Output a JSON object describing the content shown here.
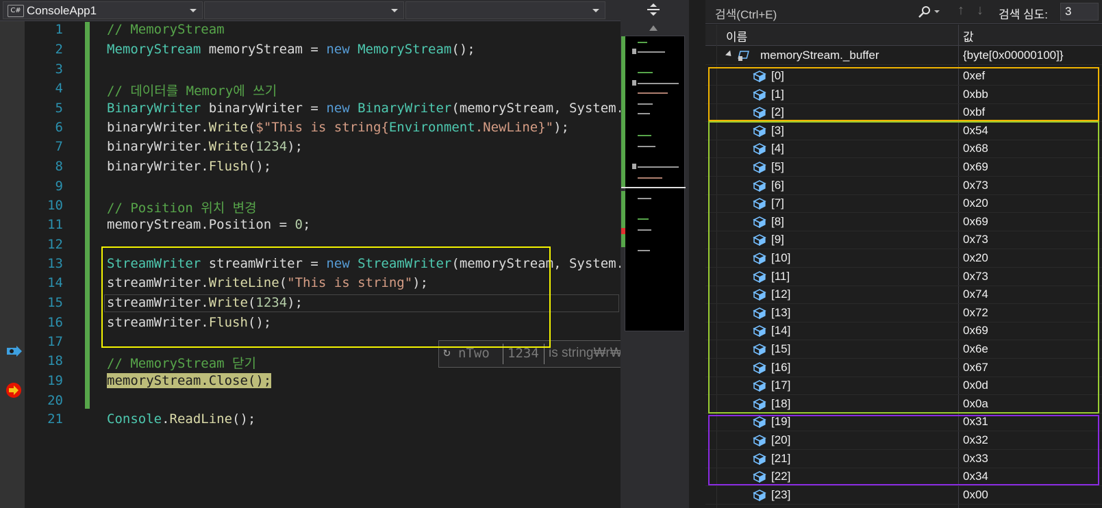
{
  "editor": {
    "dropdowns": [
      {
        "label": "ConsoleApp1",
        "badge": "C#"
      },
      {
        "label": ""
      },
      {
        "label": ""
      }
    ],
    "line_numbers": [
      "1",
      "2",
      "3",
      "4",
      "5",
      "6",
      "7",
      "8",
      "9",
      "10",
      "11",
      "12",
      "13",
      "14",
      "15",
      "16",
      "17",
      "18",
      "19",
      "20",
      "21"
    ],
    "lines": {
      "l1": "// MemoryStream",
      "l2a": "MemoryStream",
      "l2b": " memoryStream = ",
      "l2c": "new",
      "l2d": " ",
      "l2e": "MemoryStream",
      "l2f": "();",
      "l4": "// 데이터를 Memory에 쓰기",
      "l5a": "BinaryWriter",
      "l5b": " binaryWriter = ",
      "l5c": "new",
      "l5d": " ",
      "l5e": "BinaryWriter",
      "l5f": "(memoryStream, System.T",
      "l6a": "binaryWriter.",
      "l6b": "Write",
      "l6c": "(",
      "l6d": "$\"This is string{",
      "l6e": "Environment",
      "l6f": ".NewLine}\"",
      "l6g": ");",
      "l7a": "binaryWriter.",
      "l7b": "Write",
      "l7c": "(",
      "l7d": "1234",
      "l7e": ");",
      "l8a": "binaryWriter.",
      "l8b": "Flush",
      "l8c": "();",
      "l10": "// Position 위치 변경",
      "l11a": "memoryStream.Position = ",
      "l11b": "0",
      "l11c": ";",
      "l13a": "StreamWriter",
      "l13b": " streamWriter = ",
      "l13c": "new",
      "l13d": " ",
      "l13e": "StreamWriter",
      "l13f": "(memoryStream, System.T",
      "l14a": "streamWriter.",
      "l14b": "WriteLine",
      "l14c": "(",
      "l14d": "\"This is string\"",
      "l14e": ");",
      "l15a": "streamWriter.",
      "l15b": "Write",
      "l15c": "(",
      "l15d": "1234",
      "l15e": ");",
      "l16a": "streamWriter.",
      "l16b": "Flush",
      "l16c": "();",
      "l18": "// MemoryStream 닫기",
      "l19": "memoryStream.Close();",
      "l21a": "Console",
      "l21b": ".",
      "l21c": "ReadLine",
      "l21d": "();"
    },
    "tooltip_text": "nTwo",
    "tooltip_value": "1234",
    "tooltip_tail": "is string₩r₩"
  },
  "watch": {
    "search_placeholder": "검색(Ctrl+E)",
    "search_depth_label": "검색 심도:",
    "search_depth_value": "3",
    "col_name": "이름",
    "col_value": "값",
    "root": {
      "name": "memoryStream._buffer",
      "value": "{byte[0x00000100]}"
    },
    "items": [
      {
        "name": "[0]",
        "value": "0xef"
      },
      {
        "name": "[1]",
        "value": "0xbb"
      },
      {
        "name": "[2]",
        "value": "0xbf"
      },
      {
        "name": "[3]",
        "value": "0x54"
      },
      {
        "name": "[4]",
        "value": "0x68"
      },
      {
        "name": "[5]",
        "value": "0x69"
      },
      {
        "name": "[6]",
        "value": "0x73"
      },
      {
        "name": "[7]",
        "value": "0x20"
      },
      {
        "name": "[8]",
        "value": "0x69"
      },
      {
        "name": "[9]",
        "value": "0x73"
      },
      {
        "name": "[10]",
        "value": "0x20"
      },
      {
        "name": "[11]",
        "value": "0x73"
      },
      {
        "name": "[12]",
        "value": "0x74"
      },
      {
        "name": "[13]",
        "value": "0x72"
      },
      {
        "name": "[14]",
        "value": "0x69"
      },
      {
        "name": "[15]",
        "value": "0x6e"
      },
      {
        "name": "[16]",
        "value": "0x67"
      },
      {
        "name": "[17]",
        "value": "0x0d"
      },
      {
        "name": "[18]",
        "value": "0x0a"
      },
      {
        "name": "[19]",
        "value": "0x31"
      },
      {
        "name": "[20]",
        "value": "0x32"
      },
      {
        "name": "[21]",
        "value": "0x33"
      },
      {
        "name": "[22]",
        "value": "0x34"
      },
      {
        "name": "[23]",
        "value": "0x00"
      }
    ]
  },
  "colors": {
    "annotation_yellow": "#f5f500",
    "annotation_orange": "#f0b400",
    "annotation_green": "#9acd32",
    "annotation_purple": "#8a2be2"
  }
}
